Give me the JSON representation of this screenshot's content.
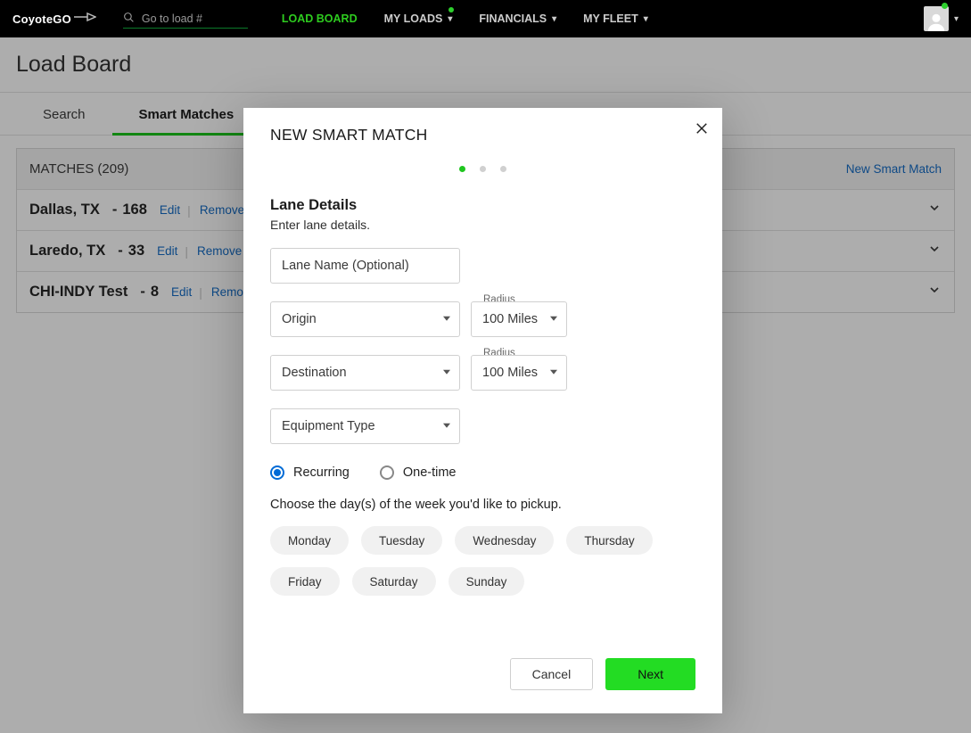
{
  "topbar": {
    "brand": "CoyoteGO",
    "search_placeholder": "Go to load #",
    "nav": [
      {
        "label": "LOAD BOARD",
        "active": true,
        "caret": false,
        "dot": false
      },
      {
        "label": "MY LOADS",
        "active": false,
        "caret": true,
        "dot": true
      },
      {
        "label": "FINANCIALS",
        "active": false,
        "caret": true,
        "dot": false
      },
      {
        "label": "MY FLEET",
        "active": false,
        "caret": true,
        "dot": false
      }
    ]
  },
  "page": {
    "title": "Load Board"
  },
  "tabs": {
    "search": "Search",
    "smart": "Smart Matches"
  },
  "matches": {
    "header": "MATCHES (209)",
    "new_link": "New Smart Match",
    "edit": "Edit",
    "remove": "Remove",
    "rows": [
      {
        "title": "Dallas, TX",
        "count": "168"
      },
      {
        "title": "Laredo, TX",
        "count": "33"
      },
      {
        "title": "CHI-INDY Test",
        "count": "8"
      }
    ]
  },
  "modal": {
    "title": "NEW SMART MATCH",
    "section_title": "Lane Details",
    "section_sub": "Enter lane details.",
    "lane_name_placeholder": "Lane Name (Optional)",
    "origin": "Origin",
    "destination": "Destination",
    "radius_label": "Radius",
    "radius_value": "100 Miles",
    "equipment": "Equipment Type",
    "recurring": "Recurring",
    "onetime": "One-time",
    "choose_text": "Choose the day(s) of the week you'd like to pickup.",
    "days": [
      "Monday",
      "Tuesday",
      "Wednesday",
      "Thursday",
      "Friday",
      "Saturday",
      "Sunday"
    ],
    "cancel": "Cancel",
    "next": "Next"
  }
}
